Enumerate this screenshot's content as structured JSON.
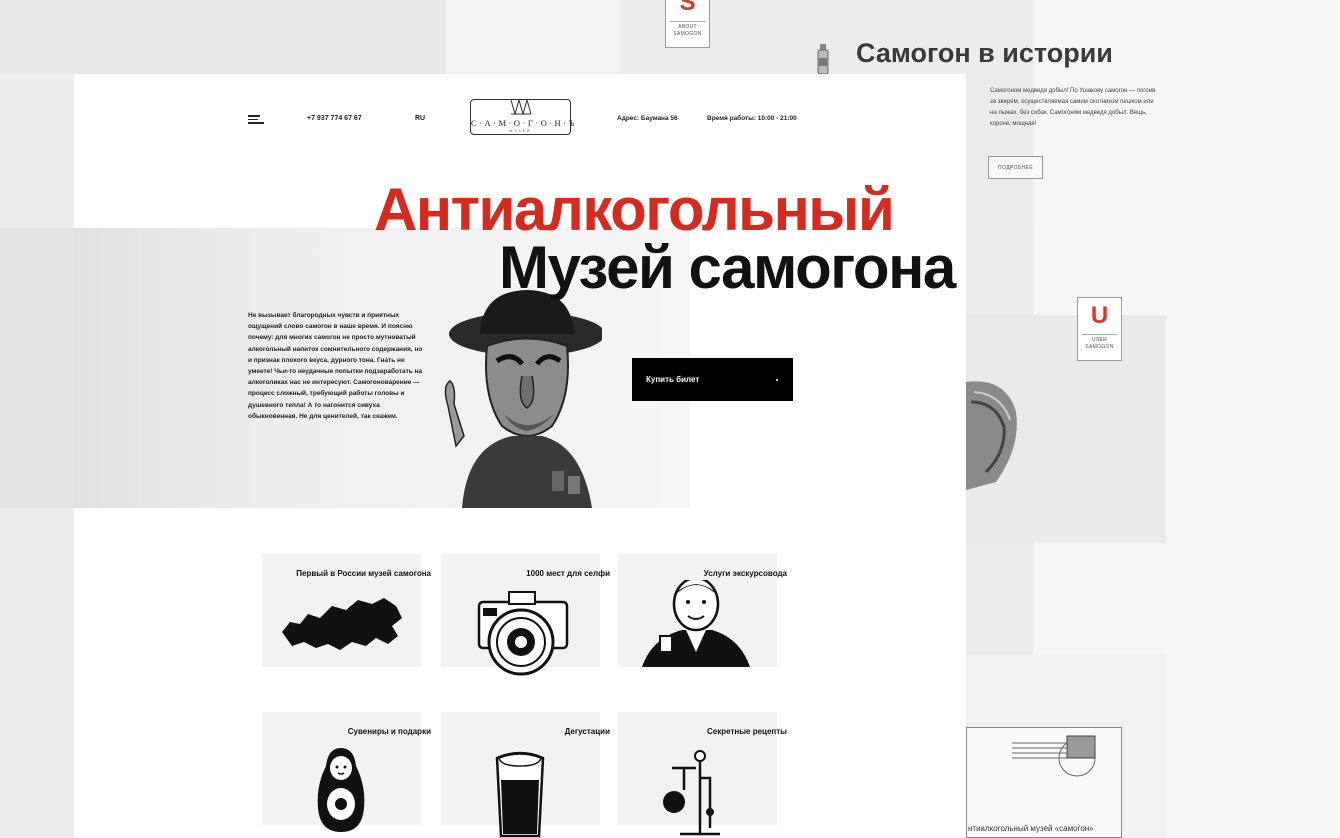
{
  "background": {
    "about_badge": {
      "letter": "S",
      "caption": "ABOUT SAMOGON"
    },
    "user_badge": {
      "letter": "U",
      "caption": "USER SAMOGON"
    },
    "history": {
      "title": "Самогон в истории",
      "text": "Самогоном медведя добыл! По Ушакову самогон — погоня за зверем, осуществляемая самим охотником пешком или на лыжах, без собак. Самогоном медведя добыл. Вещь, короче, мощная!",
      "more_button": "ПОДРОБНЕЕ"
    },
    "envelope_caption": "нтиалкогольный музей «самогон»"
  },
  "header": {
    "phone": "+7 937 774 67 67",
    "language": "RU",
    "logo_text": "С·А·М·О·Г·О·Н·Ъ",
    "logo_sub": "МУЗЕЙ",
    "address": "Адрес: Баумана 56",
    "hours": "Время работы: 10:00 - 21:00"
  },
  "hero": {
    "title_line1": "Антиалкогольный",
    "title_line2": "Музей самогона",
    "intro": "Не вызывает благородных чувств и приятных ощущений слово самогон в наше время. И поясню почему: для многих самогон не просто мутноватый алкогольный напиток сомнительного содержания, но и признак плохого вкуса, дурного тона. Гнать не умеете! Чьи-то неудачные попытки подзаработать на алкоголиках нас не интересуют. Самогоноварение — процесс сложный, требующий работы головы и душевного тепла! А то нагонится сивуха обыкновенная. Не для ценителей, так скажем.",
    "buy_button": "Купить билет"
  },
  "features": [
    {
      "title": "Первый в России музей самогона",
      "icon": "russia-map-icon"
    },
    {
      "title": "1000 мест для селфи",
      "icon": "camera-icon"
    },
    {
      "title": "Услуги экскурсовода",
      "icon": "guide-icon"
    },
    {
      "title": "Сувениры и подарки",
      "icon": "matryoshka-icon"
    },
    {
      "title": "Дегустации",
      "icon": "beer-glass-icon"
    },
    {
      "title": "Секретные рецепты",
      "icon": "flask-icon"
    }
  ],
  "colors": {
    "accent_red": "#d52a1e",
    "button_black": "#000000"
  }
}
